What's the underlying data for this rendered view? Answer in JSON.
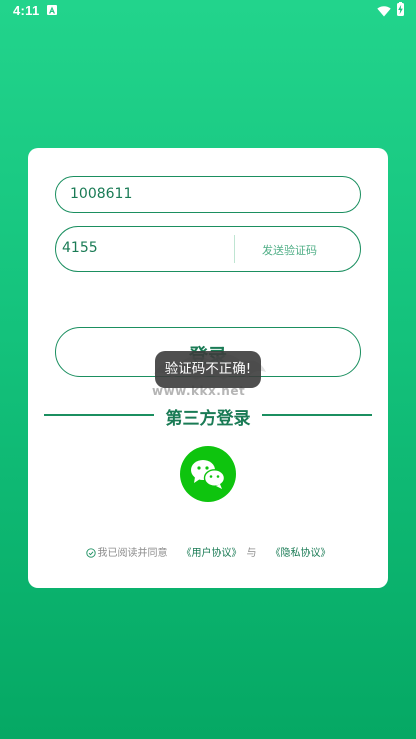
{
  "status_bar": {
    "time": "4:11",
    "app_icon": "a-letter-icon",
    "wifi_icon": "wifi-icon",
    "battery_icon": "battery-charging-icon"
  },
  "login_form": {
    "phone_value": "1008611",
    "code_value": "4155",
    "send_code_label": "发送验证码",
    "login_label": "登录"
  },
  "third_party": {
    "title": "第三方登录",
    "wechat_icon": "wechat-icon"
  },
  "agreement": {
    "prefix": "我已阅读并同意",
    "user_agreement": "《用户协议》",
    "and": "与",
    "privacy_agreement": "《隐私协议》"
  },
  "watermark": {
    "text": "www.kkx.net"
  },
  "toast": {
    "message": "验证码不正确!"
  },
  "colors": {
    "background_top": "#22d48c",
    "background_bottom": "#05a864",
    "accent": "#1b8f60",
    "wechat": "#0ec40e"
  }
}
